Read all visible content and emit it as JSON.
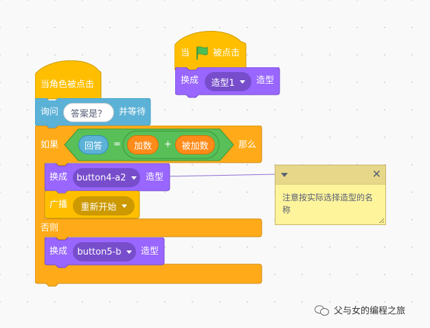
{
  "script_one": {
    "hat_label": "当角色被点击",
    "ask": {
      "label": "询问",
      "question": "答案是？",
      "suffix": "并等待"
    },
    "if_else": {
      "if_label": "如果",
      "then_label": "那么",
      "else_label": "否则",
      "condition": {
        "left": "回答",
        "operator": "=",
        "add": {
          "left": "加数",
          "operator": "+",
          "right": "被加数"
        }
      },
      "then_blocks": [
        {
          "label": "换成",
          "costume": "button4-a2",
          "suffix": "造型"
        },
        {
          "label": "广播",
          "message": "重新开始"
        }
      ],
      "else_blocks": [
        {
          "label": "换成",
          "costume": "button5-b",
          "suffix": "造型"
        }
      ]
    }
  },
  "script_two": {
    "hat_label_prefix": "当",
    "hat_label_suffix": "被点击",
    "switch": {
      "label": "换成",
      "costume": "造型1",
      "suffix": "造型"
    }
  },
  "comment": {
    "text": "注意按实际选择造型的名称"
  },
  "watermark": {
    "text": "父与女的编程之旅"
  },
  "colors": {
    "events": "#ffbf00",
    "sensing": "#5cb1d6",
    "control": "#ffab19",
    "looks": "#9966ff",
    "operators": "#59c059",
    "variable_reporter": "#ff8c1a",
    "comment": "#fef49c",
    "flag": "#4cbf56"
  },
  "icons": [
    "green-flag-icon",
    "dropdown-caret-icon",
    "comment-collapse-icon",
    "close-icon",
    "resize-grip-icon",
    "wechat-icon"
  ]
}
